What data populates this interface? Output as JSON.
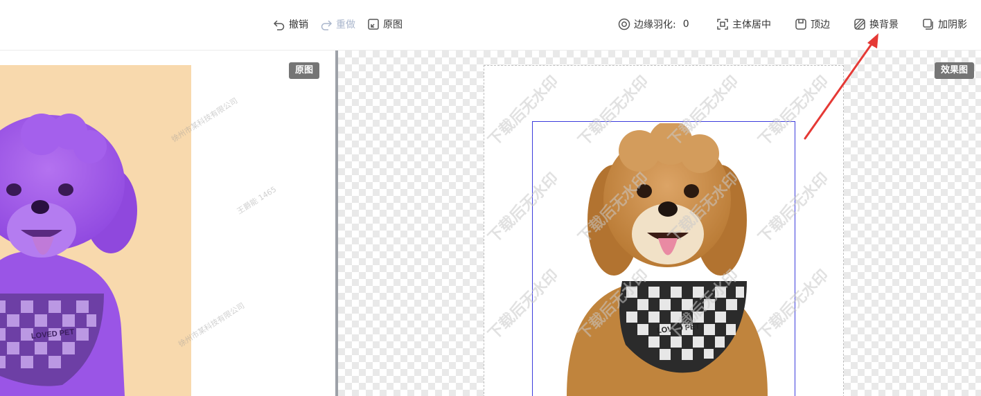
{
  "toolbar": {
    "undo": "撤销",
    "redo": "重做",
    "original": "原图",
    "feather_label": "边缘羽化:",
    "feather_value": "0",
    "center": "主体居中",
    "top_edge": "顶边",
    "change_bg": "换背景",
    "add_shadow": "加阴影"
  },
  "left_pane": {
    "badge": "原图",
    "photo_text": "LOVED PET",
    "watermarks": [
      "徐州市某科技有限公司",
      "王爵能 1465"
    ]
  },
  "right_pane": {
    "badge": "效果图",
    "photo_text": "LOVED PET",
    "watermark": "下载后无水印"
  },
  "colors": {
    "select_box": "#3b3bdc",
    "arrow": "#e53935",
    "badge_bg": "#757575",
    "dog_fur": "#c88a3e",
    "tint_purple": "#9a55e6"
  },
  "icons": {
    "undo": "undo-icon",
    "redo": "redo-icon",
    "original": "original-icon",
    "feather": "feather-icon",
    "center": "center-icon",
    "top_edge": "top-edge-icon",
    "change_bg": "change-bg-icon",
    "shadow": "shadow-icon"
  }
}
